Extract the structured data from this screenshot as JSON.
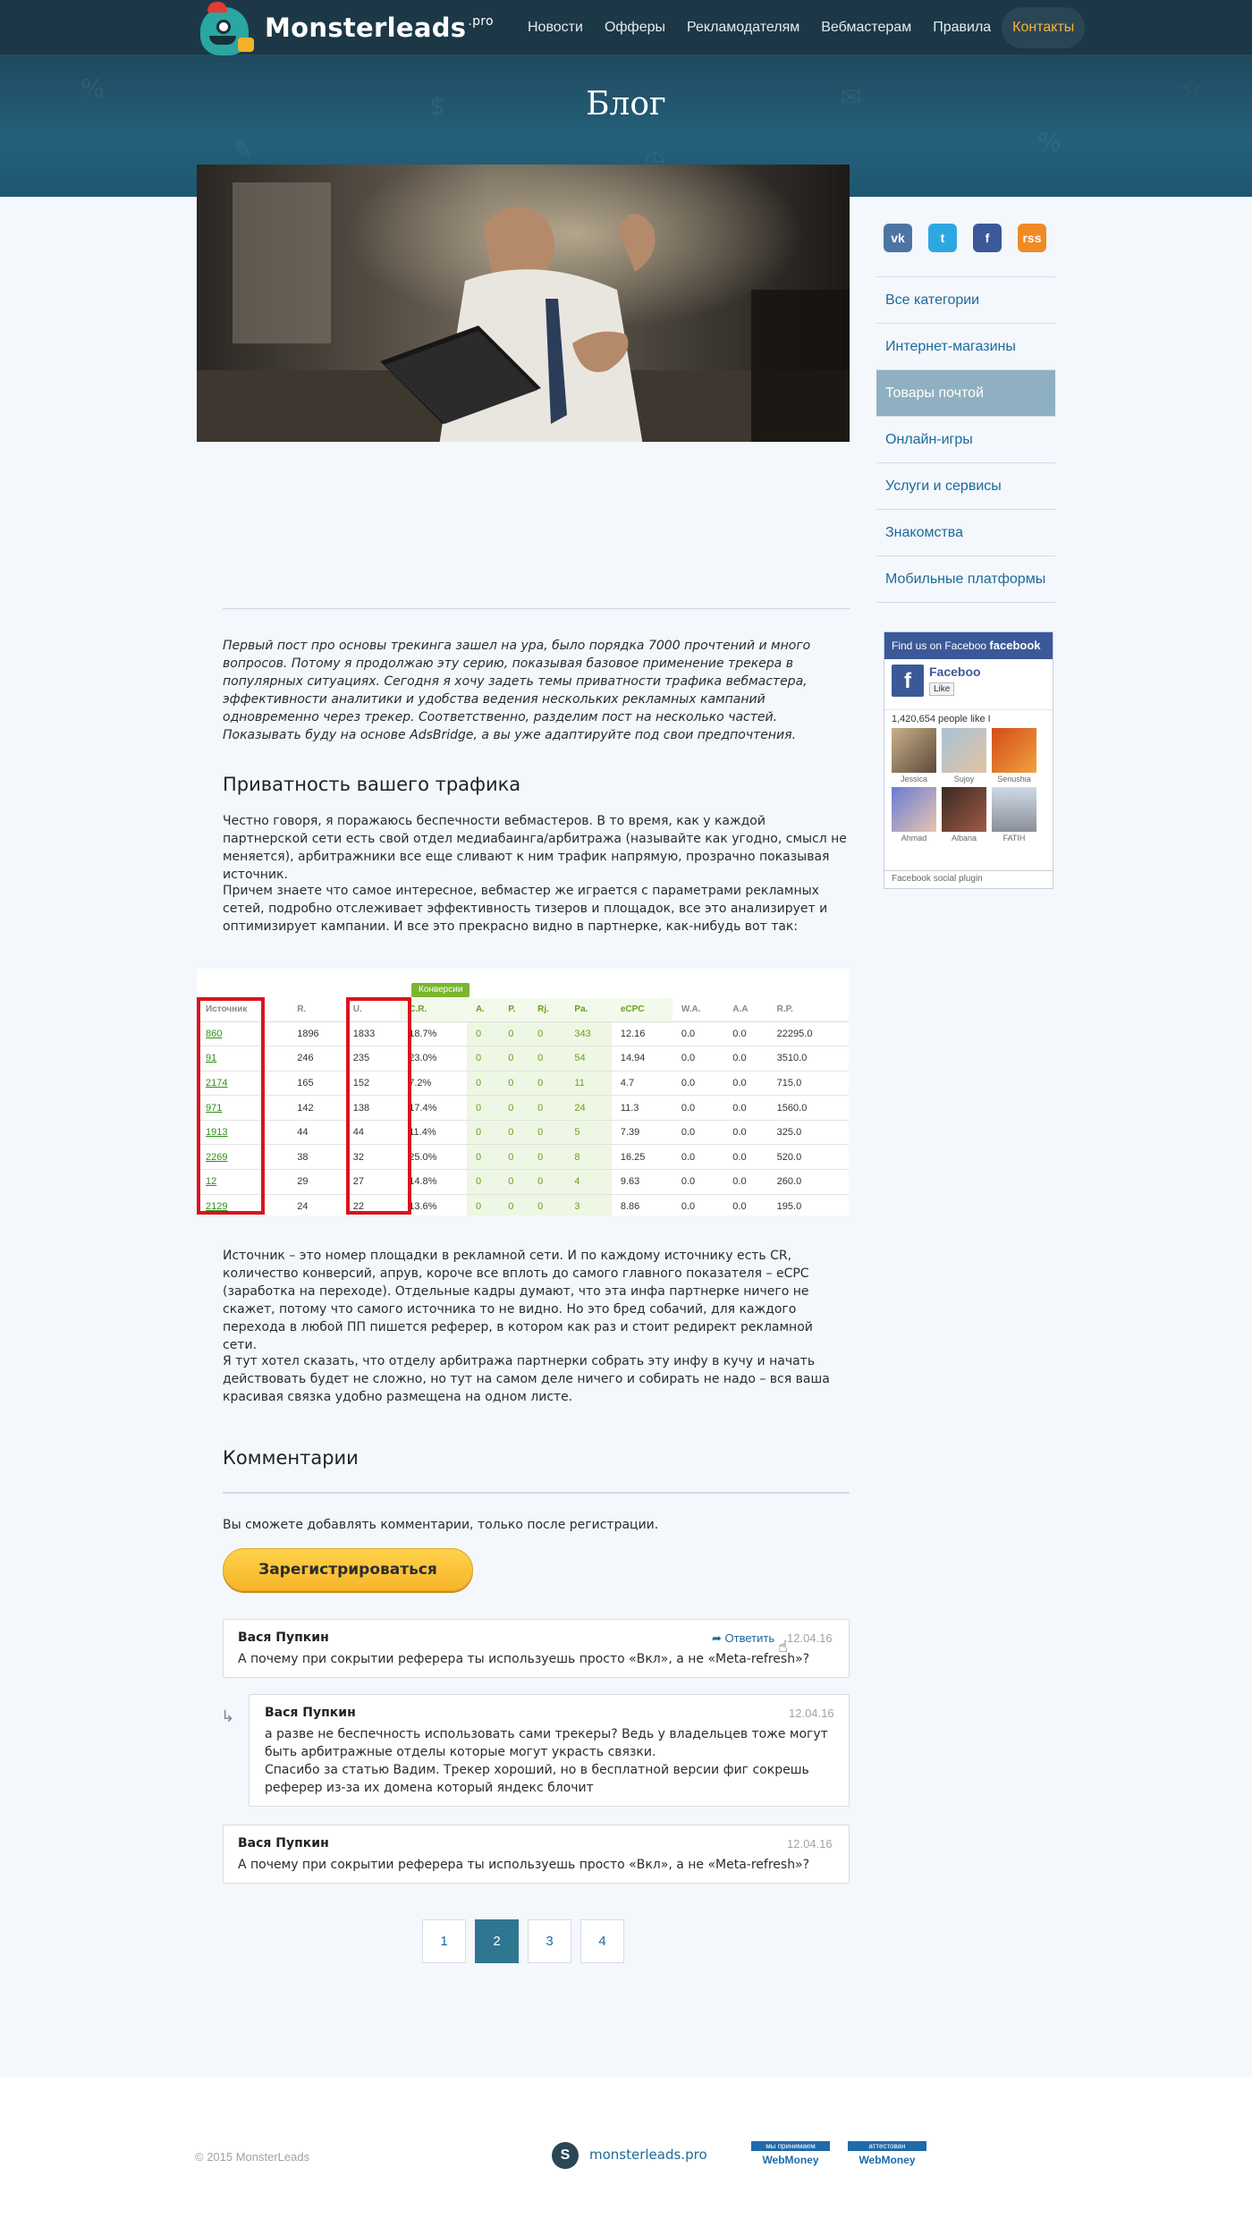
{
  "brand": {
    "name": "Monsterleads",
    "suffix": ".pro"
  },
  "nav": [
    "Новости",
    "Офферы",
    "Рекламодателям",
    "Вебмастерам",
    "Правила",
    "Контакты"
  ],
  "hero": {
    "title": "Блог"
  },
  "social": {
    "vk": "vk",
    "twitter": "t",
    "facebook": "f",
    "rss": "rss"
  },
  "categories": [
    "Все категории",
    "Интернет-магазины",
    "Товары почтой",
    "Онлайн-игры",
    "Услуги и сервисы",
    "Знакомства",
    "Мобильные платформы"
  ],
  "fb": {
    "header": "Find us on Faceboo",
    "header_brand": "facebook",
    "page_name": "Faceboo",
    "like": "Like",
    "count": "1,420,654 people like I",
    "faces": [
      "Jessica",
      "Sujoy",
      "Senushia",
      "Ahmad",
      "Albana",
      "FATIH"
    ],
    "footer": "Facebook social plugin"
  },
  "article": {
    "intro": "Первый пост про основы трекинга зашел на ура, было порядка 7000 прочтений и много вопросов. Потому я продолжаю эту серию, показывая базовое применение трекера в популярных ситуациях. Сегодня я хочу задеть темы приватности трафика вебмастера, эффективности аналитики и удобства ведения нескольких рекламных кампаний одновременно через трекер. Соответственно, разделим пост на несколько частей. Показывать буду на основе AdsBridge, а вы уже адаптируйте под свои предпочтения.",
    "h2": "Приватность вашего трафика",
    "p1": "Честно говоря, я поражаюсь беспечности вебмастеров. В то время, как у каждой партнерской сети есть свой отдел медиабаинга/арбитража (называйте как угодно, смысл не меняется), арбитражники все еще сливают к ним трафик напрямую, прозрачно показывая источник.",
    "p2": "Причем знаете что самое интересное, вебмастер же играется с параметрами рекламных сетей, подробно отслеживает эффективность тизеров и площадок, все это анализирует и оптимизирует кампании. И все это прекрасно видно в партнерке, как-нибудь вот так:",
    "p3": "Источник – это номер площадки в рекламной сети. И по каждому источнику есть CR, количество конверсий, апрув, короче все вплоть до самого главного показателя – eCPC (заработка на переходе). Отдельные кадры думают, что эта инфа партнерке ничего не скажет, потому что самого источника то не видно. Но это бред собачий, для каждого перехода в любой ПП пишется реферер, в котором как раз и стоит редирект рекламной сети.",
    "p4": "Я тут хотел сказать, что отделу арбитража партнерки собрать эту инфу в кучу и начать действовать будет не сложно, но тут на самом деле ничего и собирать не надо – вся ваша красивая связка удобно размещена на одном листе."
  },
  "stats": {
    "group_label": "Конверсии",
    "headers": [
      "Источник",
      "R.",
      "U.",
      "C.R.",
      "A.",
      "P.",
      "Rj.",
      "Pa.",
      "eCPC",
      "W.A.",
      "A.A",
      "R.P."
    ],
    "rows": [
      [
        "860",
        "1896",
        "1833",
        "18.7%",
        "0",
        "0",
        "0",
        "343",
        "12.16",
        "0.0",
        "0.0",
        "22295.0"
      ],
      [
        "91",
        "246",
        "235",
        "23.0%",
        "0",
        "0",
        "0",
        "54",
        "14.94",
        "0.0",
        "0.0",
        "3510.0"
      ],
      [
        "2174",
        "165",
        "152",
        "7.2%",
        "0",
        "0",
        "0",
        "11",
        "4.7",
        "0.0",
        "0.0",
        "715.0"
      ],
      [
        "971",
        "142",
        "138",
        "17.4%",
        "0",
        "0",
        "0",
        "24",
        "11.3",
        "0.0",
        "0.0",
        "1560.0"
      ],
      [
        "1913",
        "44",
        "44",
        "11.4%",
        "0",
        "0",
        "0",
        "5",
        "7.39",
        "0.0",
        "0.0",
        "325.0"
      ],
      [
        "2269",
        "38",
        "32",
        "25.0%",
        "0",
        "0",
        "0",
        "8",
        "16.25",
        "0.0",
        "0.0",
        "520.0"
      ],
      [
        "12",
        "29",
        "27",
        "14.8%",
        "0",
        "0",
        "0",
        "4",
        "9.63",
        "0.0",
        "0.0",
        "260.0"
      ],
      [
        "2129",
        "24",
        "22",
        "13.6%",
        "0",
        "0",
        "0",
        "3",
        "8.86",
        "0.0",
        "0.0",
        "195.0"
      ]
    ]
  },
  "comments": {
    "title": "Комментарии",
    "note": "Вы сможете добавлять комментарии, только после регистрации.",
    "register": "Зарегистрироваться",
    "reply": "Ответить",
    "items": [
      {
        "author": "Вася Пупкин",
        "date": "12.04.16",
        "text": "А почему при сокрытии реферера ты используешь просто «Вкл», а не «Meta-refresh»?"
      },
      {
        "author": "Вася Пупкин",
        "date": "12.04.16",
        "text": " а разве не беспечность использовать сами трекеры? Ведь у владельцев тоже могут быть арбитражные отделы которые могут украсть связки.\nСпасибо за статью Вадим. Трекер хороший, но в бесплатной версии фиг сокрешь реферер из-за их домена который яндекс блочит"
      },
      {
        "author": "Вася Пупкин",
        "date": "12.04.16",
        "text": "А почему при сокрытии реферера ты используешь просто «Вкл», а не «Meta-refresh»?"
      }
    ]
  },
  "pagination": [
    "1",
    "2",
    "3",
    "4"
  ],
  "footer": {
    "copyright": "© 2015 MonsterLeads",
    "skype": "S",
    "site": "monsterleads.pro",
    "wm1_top": "мы принимаем",
    "wm2_top": "аттестован",
    "wm_brand": "WebMoney"
  }
}
